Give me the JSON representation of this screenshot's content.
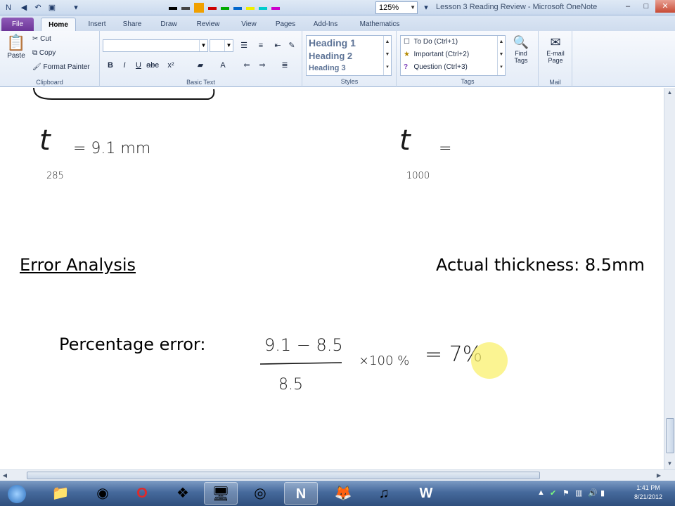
{
  "window": {
    "title": "Lesson 3 Reading Review - Microsoft OneNote",
    "zoom": "125%",
    "controls": {
      "minimize": "–",
      "maximize": "□",
      "close": "✕"
    }
  },
  "ribbon_tabs": [
    "File",
    "Home",
    "Insert",
    "Share",
    "Draw",
    "Review",
    "View",
    "Pages",
    "Add-Ins",
    "Mathematics"
  ],
  "clipboard": {
    "paste": "Paste",
    "cut": "Cut",
    "copy": "Copy",
    "format_painter": "Format Painter",
    "label": "Clipboard"
  },
  "basic_text": {
    "label": "Basic Text"
  },
  "styles": {
    "items": [
      "Heading 1",
      "Heading 2",
      "Heading 3"
    ],
    "label": "Styles"
  },
  "tags": {
    "items": [
      "To Do (Ctrl+1)",
      "Important (Ctrl+2)",
      "Question (Ctrl+3)"
    ],
    "label": "Tags",
    "find_tags": [
      "Find",
      "Tags"
    ]
  },
  "mail": {
    "button": [
      "E-mail",
      "Page"
    ],
    "label": "Mail"
  },
  "note": {
    "eq1": {
      "var": "t",
      "sub": "285",
      "rhs": "= 9.1 mm"
    },
    "eq2": {
      "var": "t",
      "sub": "1000",
      "rhs": "="
    },
    "error_analysis": "Error Analysis",
    "actual_thickness": "Actual thickness: 8.5mm",
    "percentage_error": "Percentage error:",
    "numerator": "9.1 − 8.5",
    "denominator": "8.5",
    "multiplier": "×100 %",
    "result": "= 7%"
  },
  "taskbar": {
    "time": "1:41 PM",
    "date": "8/21/2012"
  }
}
